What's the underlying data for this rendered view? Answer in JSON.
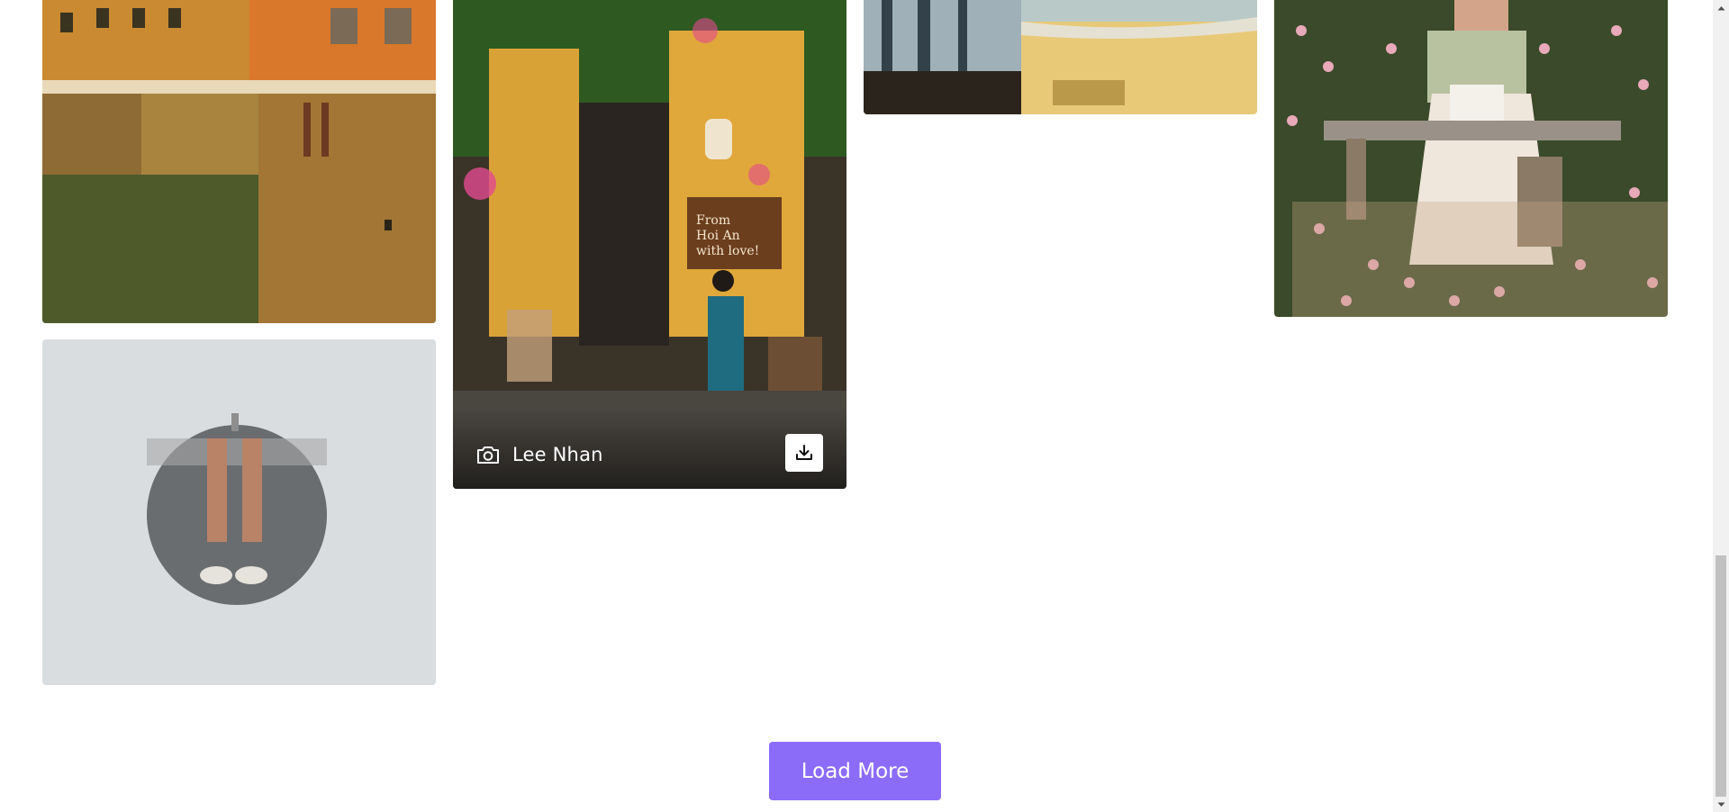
{
  "gallery": {
    "photos": [
      {
        "name": "florence-buildings",
        "alt": ""
      },
      {
        "name": "mirror-feet",
        "alt": ""
      },
      {
        "name": "hoi-an-cafe",
        "alt": "",
        "sign_text": "From\nHoi An\nwith love!"
      },
      {
        "name": "beach",
        "alt": ""
      },
      {
        "name": "woman-bench-flowers",
        "alt": ""
      }
    ],
    "featured_credit": {
      "photographer": "Lee Nhan",
      "icon": "camera-icon",
      "action_icon": "download-icon"
    }
  },
  "load_more": {
    "label": "Load More",
    "color": "#8b6cf9"
  }
}
